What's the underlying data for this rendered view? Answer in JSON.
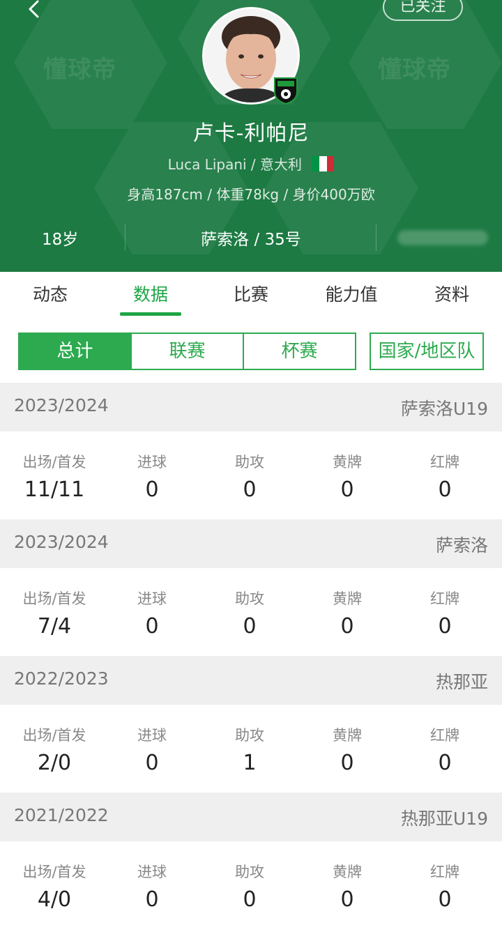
{
  "header": {
    "watermark": "懂球帝",
    "follow_label": "已关注",
    "player_name": "卢卡-利帕尼",
    "sub_line": "Luca Lipani / 意大利",
    "flag_colors": [
      "#009246",
      "#ffffff",
      "#ce2b37"
    ],
    "body_line": "身高187cm / 体重78kg / 身价400万欧",
    "age": "18岁",
    "club_number": "萨索洛 / 35号"
  },
  "tabs": [
    {
      "label": "动态"
    },
    {
      "label": "数据"
    },
    {
      "label": "比赛"
    },
    {
      "label": "能力值"
    },
    {
      "label": "资料"
    }
  ],
  "filters": [
    {
      "label": "总计"
    },
    {
      "label": "联赛"
    },
    {
      "label": "杯赛"
    },
    {
      "label": "国家/地区队"
    }
  ],
  "stat_labels": [
    "出场/首发",
    "进球",
    "助攻",
    "黄牌",
    "红牌"
  ],
  "seasons": [
    {
      "year": "2023/2024",
      "team": "萨索洛U19",
      "values": [
        "11/11",
        "0",
        "0",
        "0",
        "0"
      ]
    },
    {
      "year": "2023/2024",
      "team": "萨索洛",
      "values": [
        "7/4",
        "0",
        "0",
        "0",
        "0"
      ]
    },
    {
      "year": "2022/2023",
      "team": "热那亚",
      "values": [
        "2/0",
        "0",
        "1",
        "0",
        "0"
      ]
    },
    {
      "year": "2021/2022",
      "team": "热那亚U19",
      "values": [
        "4/0",
        "0",
        "0",
        "0",
        "0"
      ]
    }
  ],
  "colors": {
    "header_bg": "#1c7a42",
    "accent": "#1ea546"
  }
}
